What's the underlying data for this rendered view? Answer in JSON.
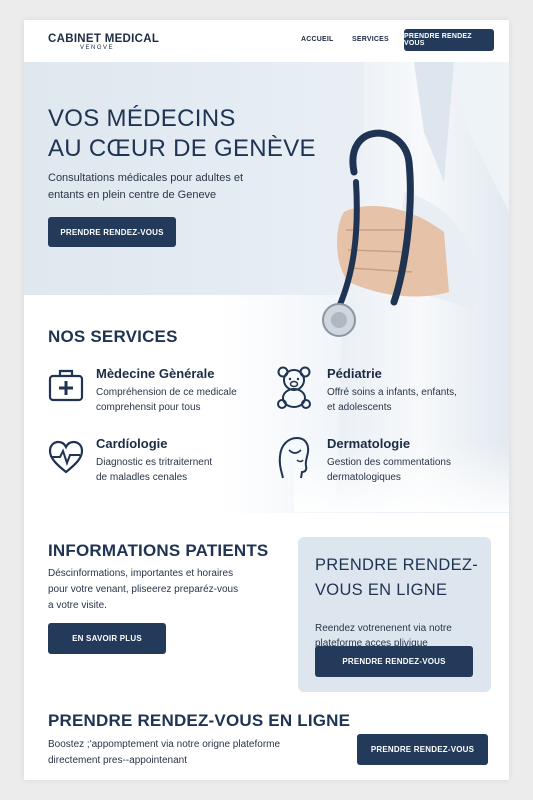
{
  "nav": {
    "logo_title": "CABINET MEDICAL",
    "logo_sub": "VENGVE",
    "links": [
      "ACCUEIL",
      "SERVICES"
    ],
    "cta": "PRENDRE RENDEZ VOUS"
  },
  "hero": {
    "title_line1": "VOS MÉDECINS",
    "title_line2": "AU CŒUR DE GENÈVE",
    "subtitle": "Consultations médicales pour adultes et entants en plein centre de Geneve",
    "cta": "PRENDRE RENDEZ-VOUS"
  },
  "services": {
    "heading": "NOS SERVICES",
    "items": [
      {
        "title": "Mèdecine Gènérale",
        "desc1": "Compréhension de ce medicale",
        "desc2": "comprehensit pour tous",
        "icon": "medical-kit-icon"
      },
      {
        "title": "Pédiatrie",
        "desc1": "Offré soins a infants, enfants,",
        "desc2": "et adolescents",
        "icon": "teddy-bear-icon"
      },
      {
        "title": "Cardíologie",
        "desc1": "Diagnostic es tritraiternent",
        "desc2": "de maladles cenales",
        "icon": "heart-pulse-icon"
      },
      {
        "title": "Dermatologie",
        "desc1": "Gestion des commentations",
        "desc2": "dermatologiques",
        "icon": "face-profile-icon"
      }
    ]
  },
  "info": {
    "heading": "INFORMATIONS PATIENTS",
    "line1": "Déscinformations, importantes et horaires",
    "line2": "pour votre venant, pliseerez preparéz-vous",
    "line3": "a votre visite.",
    "cta": "EN SAVOIR PLUS"
  },
  "card": {
    "title_line1": "PRENDRE RENDEZ-",
    "title_line2": "VOUS EN LIGNE",
    "desc1": "Reendez votrenenent via notre",
    "desc2": "plateforme acces plivique",
    "cta": "PRENDRE RENDEZ-VOUS"
  },
  "online": {
    "heading": "PRENDRE RENDEZ-VOUS EN LIGNE",
    "line1": "Boostez ;'appomptement via notre origne plateforme",
    "line2": "directement pres--appointenant",
    "cta": "PRENDRE RENDEZ-VOUS"
  },
  "colors": {
    "navy": "#233a5a",
    "hero_bg": "#dfe7ef",
    "card_bg": "#dde6ef"
  }
}
